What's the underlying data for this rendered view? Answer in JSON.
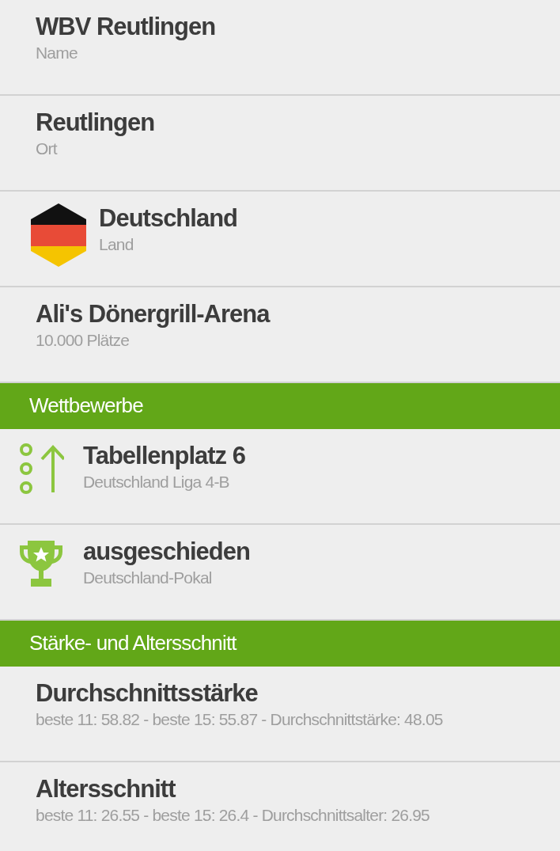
{
  "rows": [
    {
      "kind": "plain",
      "title": "WBV Reutlingen",
      "subtitle": "Name"
    },
    {
      "kind": "plain",
      "title": "Reutlingen",
      "subtitle": "Ort"
    },
    {
      "kind": "flag",
      "title": "Deutschland",
      "subtitle": "Land"
    },
    {
      "kind": "plain",
      "title": "Ali's Dönergrill-Arena",
      "subtitle": "10.000 Plätze"
    },
    {
      "kind": "header",
      "title": "Wettbewerbe"
    },
    {
      "kind": "rank",
      "title": "Tabellenplatz 6",
      "subtitle": "Deutschland Liga 4-B"
    },
    {
      "kind": "trophy",
      "title": "ausgeschieden",
      "subtitle": "Deutschland-Pokal"
    },
    {
      "kind": "header",
      "title": "Stärke- und Altersschnitt"
    },
    {
      "kind": "plain",
      "title": "Durchschnittsstärke",
      "subtitle": "beste 11: 58.82 - beste 15: 55.87 - Durchschnittstärke: 48.05"
    },
    {
      "kind": "plain",
      "title": "Altersschnitt",
      "subtitle": "beste 11: 26.55 - beste 15: 26.4 - Durchschnittsalter: 26.95"
    }
  ]
}
